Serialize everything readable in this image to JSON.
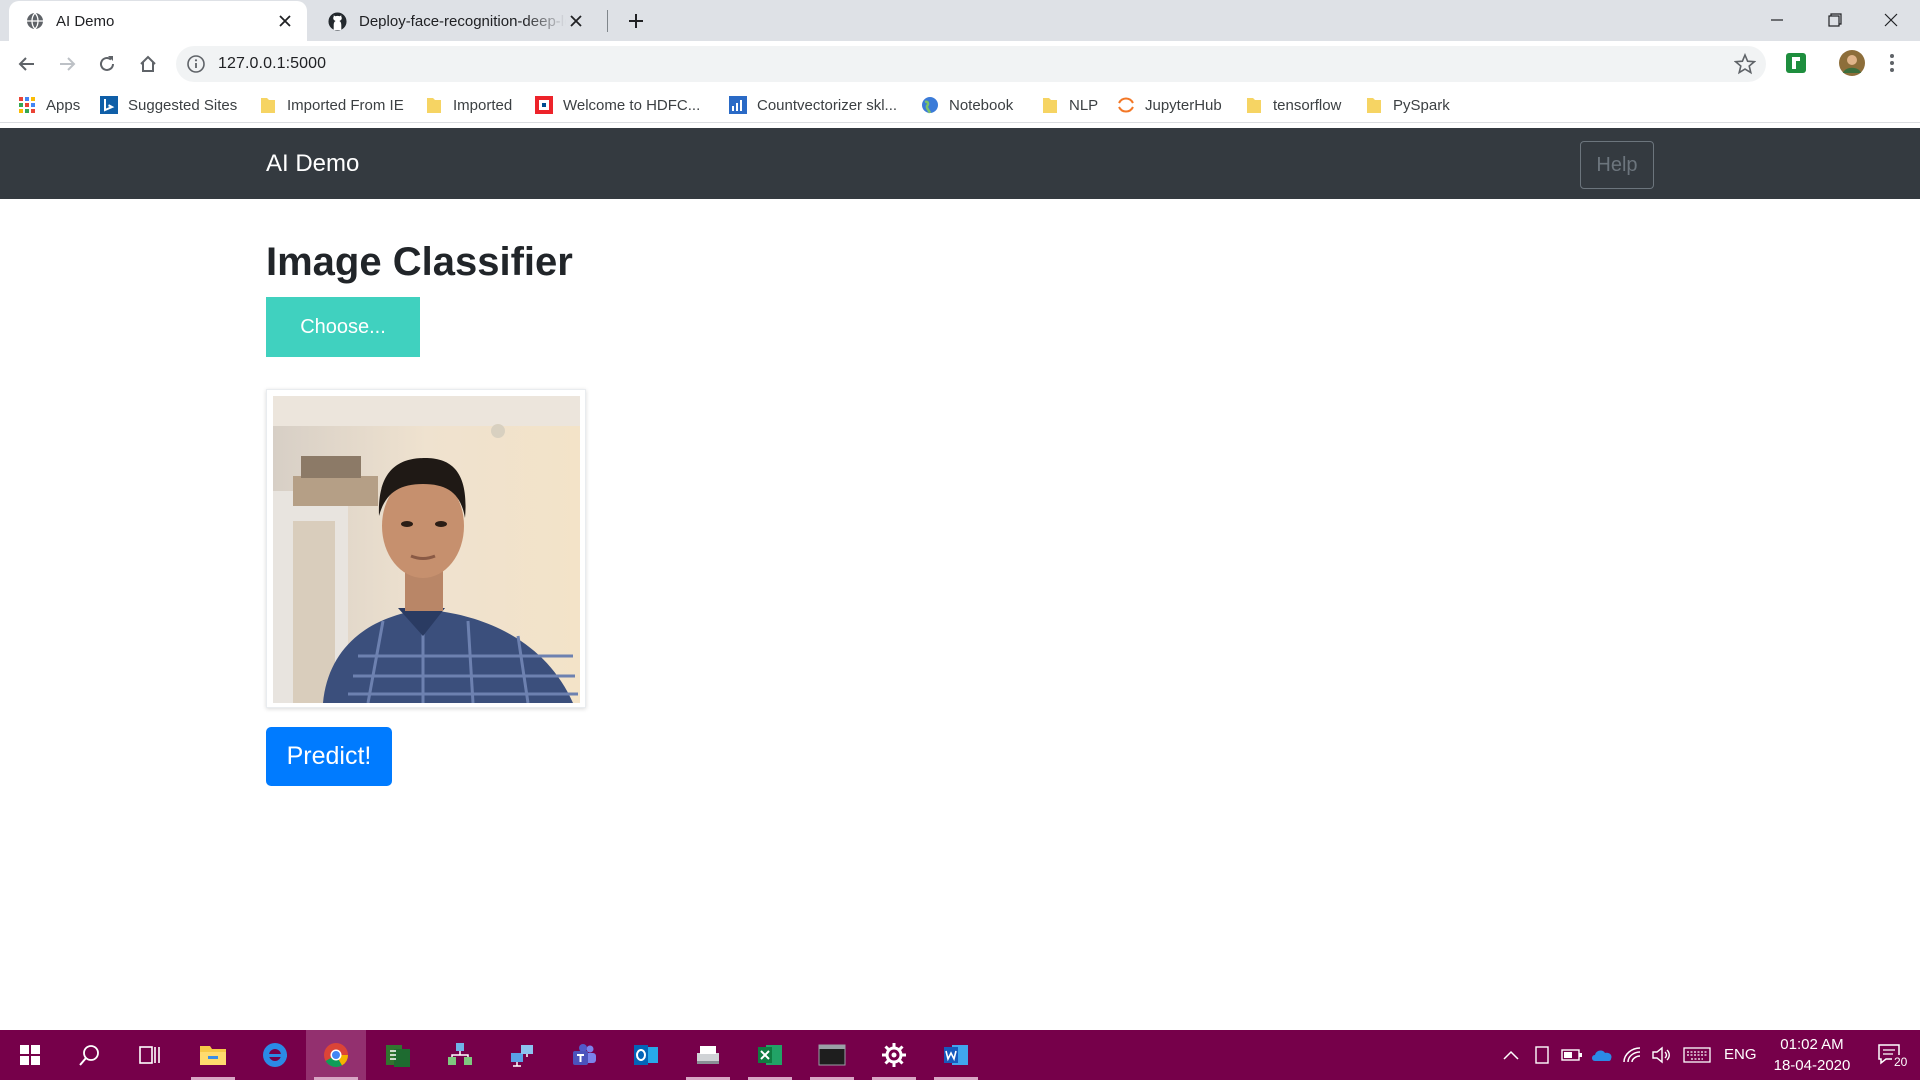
{
  "browser": {
    "tabs": [
      {
        "title": "AI Demo",
        "active": true
      },
      {
        "title": "Deploy-face-recognition-deep-le",
        "active": false
      }
    ],
    "url": "127.0.0.1:5000",
    "bookmarks": [
      {
        "label": "Apps",
        "icon": "apps-grid-icon"
      },
      {
        "label": "Suggested Sites",
        "icon": "bing-icon"
      },
      {
        "label": "Imported From IE",
        "icon": "folder-icon"
      },
      {
        "label": "Imported",
        "icon": "folder-icon"
      },
      {
        "label": "Welcome to HDFC...",
        "icon": "hdfc-icon"
      },
      {
        "label": "Countvectorizer skl...",
        "icon": "chart-icon"
      },
      {
        "label": "Notebook",
        "icon": "globe-icon"
      },
      {
        "label": "NLP",
        "icon": "folder-icon"
      },
      {
        "label": "JupyterHub",
        "icon": "jupyter-icon"
      },
      {
        "label": "tensorflow",
        "icon": "folder-icon"
      },
      {
        "label": "PySpark",
        "icon": "folder-icon"
      }
    ]
  },
  "page": {
    "brand": "AI Demo",
    "help_label": "Help",
    "title": "Image Classifier",
    "choose_label": "Choose...",
    "predict_label": "Predict!",
    "colors": {
      "navbar": "#343a40",
      "choose": "#40d1bf",
      "predict": "#007bff"
    }
  },
  "taskbar": {
    "apps": [
      "start-icon",
      "search-icon",
      "task-view-icon",
      "file-explorer-icon",
      "edge-icon",
      "chrome-icon",
      "project-icon",
      "network-app-icon",
      "remote-icon",
      "teams-icon",
      "outlook-icon",
      "scanner-icon",
      "excel-icon",
      "terminal-icon",
      "settings-icon",
      "word-icon"
    ],
    "language": "ENG",
    "time": "01:02 AM",
    "date": "18-04-2020",
    "notifications": "20",
    "color": "#76004a"
  }
}
